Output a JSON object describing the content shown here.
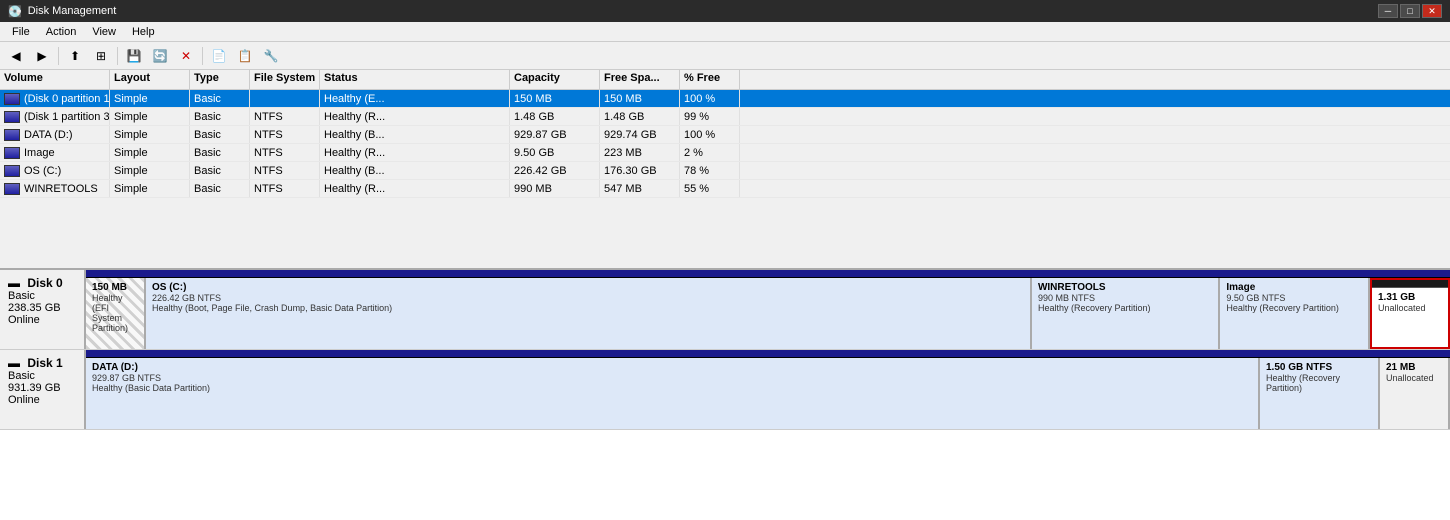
{
  "app": {
    "title": "Disk Management",
    "menus": [
      "File",
      "Action",
      "View",
      "Help"
    ]
  },
  "toolbar": {
    "buttons": [
      "←",
      "→",
      "↑",
      "↓",
      "⊞",
      "🖫",
      "✕",
      "⊠",
      "📄",
      "📋",
      "🔧"
    ]
  },
  "table": {
    "headers": [
      "Volume",
      "Layout",
      "Type",
      "File System",
      "Status",
      "Capacity",
      "Free Spa...",
      "% Free"
    ],
    "rows": [
      {
        "volume": "(Disk 0 partition 1)",
        "layout": "Simple",
        "type": "Basic",
        "fs": "",
        "status": "Healthy (E...",
        "capacity": "150 MB",
        "free": "150 MB",
        "pct": "100 %",
        "selected": true
      },
      {
        "volume": "(Disk 1 partition 3)",
        "layout": "Simple",
        "type": "Basic",
        "fs": "NTFS",
        "status": "Healthy (R...",
        "capacity": "1.48 GB",
        "free": "1.48 GB",
        "pct": "99 %",
        "selected": false
      },
      {
        "volume": "DATA (D:)",
        "layout": "Simple",
        "type": "Basic",
        "fs": "NTFS",
        "status": "Healthy (B...",
        "capacity": "929.87 GB",
        "free": "929.74 GB",
        "pct": "100 %",
        "selected": false
      },
      {
        "volume": "Image",
        "layout": "Simple",
        "type": "Basic",
        "fs": "NTFS",
        "status": "Healthy (R...",
        "capacity": "9.50 GB",
        "free": "223 MB",
        "pct": "2 %",
        "selected": false
      },
      {
        "volume": "OS (C:)",
        "layout": "Simple",
        "type": "Basic",
        "fs": "NTFS",
        "status": "Healthy (B...",
        "capacity": "226.42 GB",
        "free": "176.30 GB",
        "pct": "78 %",
        "selected": false
      },
      {
        "volume": "WINRETOOLS",
        "layout": "Simple",
        "type": "Basic",
        "fs": "NTFS",
        "status": "Healthy (R...",
        "capacity": "990 MB",
        "free": "547 MB",
        "pct": "55 %",
        "selected": false
      }
    ]
  },
  "disk0": {
    "label": "Disk 0",
    "type": "Basic",
    "size": "238.35 GB",
    "status": "Online",
    "partitions": [
      {
        "name": "150 MB",
        "detail1": "Healthy (EFI System Partition)",
        "type": "efi"
      },
      {
        "name": "OS (C:)",
        "detail1": "226.42 GB NTFS",
        "detail2": "Healthy (Boot, Page File, Crash Dump, Basic Data Partition)",
        "type": "os"
      },
      {
        "name": "WINRETOOLS",
        "detail1": "990 MB NTFS",
        "detail2": "Healthy (Recovery Partition)",
        "type": "winretools"
      },
      {
        "name": "Image",
        "detail1": "9.50 GB NTFS",
        "detail2": "Healthy (Recovery Partition)",
        "type": "image"
      },
      {
        "name": "1.31 GB",
        "detail1": "Unallocated",
        "type": "unallocated"
      }
    ]
  },
  "disk1": {
    "label": "Disk 1",
    "type": "Basic",
    "size": "931.39 GB",
    "status": "Online",
    "partitions": [
      {
        "name": "DATA (D:)",
        "detail1": "929.87 GB NTFS",
        "detail2": "Healthy (Basic Data Partition)",
        "type": "data"
      },
      {
        "name": "1.50 GB NTFS",
        "detail1": "Healthy (Recovery Partition)",
        "type": "recovery-small"
      },
      {
        "name": "21 MB",
        "detail1": "Unallocated",
        "type": "unalloc-small"
      }
    ]
  }
}
